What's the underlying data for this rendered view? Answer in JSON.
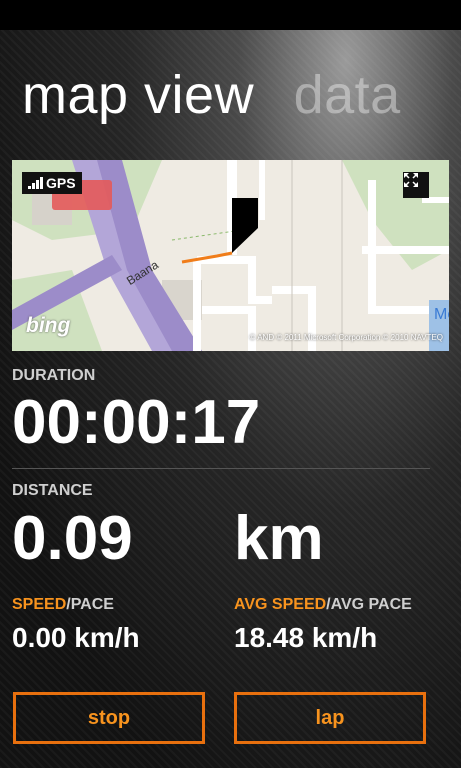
{
  "colors": {
    "accent": "#f7931e",
    "button_border": "#e8700e",
    "background": "#1b1b1b"
  },
  "pivot": {
    "active": "map view",
    "inactive": "data"
  },
  "map": {
    "gps_label": "GPS",
    "gps_icon": "signal-bars-icon",
    "expand_icon": "expand-arrows-icon",
    "provider": "bing",
    "road_label": "Baana",
    "edge_label": "Me",
    "credit": "© AND © 2011 Microsoft Corporation © 2010 NAVTEQ"
  },
  "duration": {
    "label": "DURATION",
    "value": "00:00:17"
  },
  "distance": {
    "label": "DISTANCE",
    "value": "0.09",
    "unit": "km"
  },
  "speed": {
    "label_highlight": "SPEED",
    "label_rest": "/PACE",
    "value": "0.00 km/h"
  },
  "avg_speed": {
    "label_highlight": "AVG SPEED",
    "label_rest": "/AVG PACE",
    "value": "18.48 km/h"
  },
  "buttons": {
    "stop": "stop",
    "lap": "lap"
  }
}
